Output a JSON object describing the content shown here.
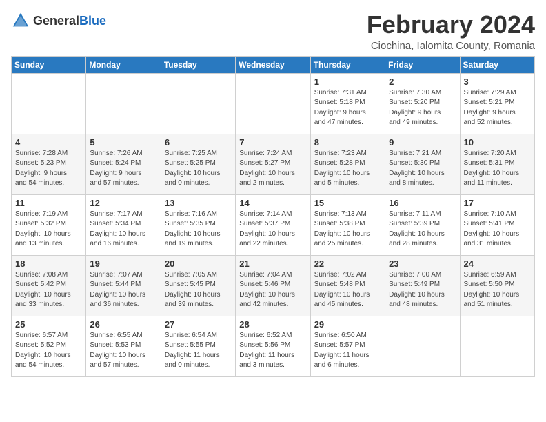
{
  "header": {
    "logo_general": "General",
    "logo_blue": "Blue",
    "title": "February 2024",
    "subtitle": "Ciochina, Ialomita County, Romania"
  },
  "weekdays": [
    "Sunday",
    "Monday",
    "Tuesday",
    "Wednesday",
    "Thursday",
    "Friday",
    "Saturday"
  ],
  "weeks": [
    [
      {
        "day": "",
        "details": ""
      },
      {
        "day": "",
        "details": ""
      },
      {
        "day": "",
        "details": ""
      },
      {
        "day": "",
        "details": ""
      },
      {
        "day": "1",
        "details": "Sunrise: 7:31 AM\nSunset: 5:18 PM\nDaylight: 9 hours\nand 47 minutes."
      },
      {
        "day": "2",
        "details": "Sunrise: 7:30 AM\nSunset: 5:20 PM\nDaylight: 9 hours\nand 49 minutes."
      },
      {
        "day": "3",
        "details": "Sunrise: 7:29 AM\nSunset: 5:21 PM\nDaylight: 9 hours\nand 52 minutes."
      }
    ],
    [
      {
        "day": "4",
        "details": "Sunrise: 7:28 AM\nSunset: 5:23 PM\nDaylight: 9 hours\nand 54 minutes."
      },
      {
        "day": "5",
        "details": "Sunrise: 7:26 AM\nSunset: 5:24 PM\nDaylight: 9 hours\nand 57 minutes."
      },
      {
        "day": "6",
        "details": "Sunrise: 7:25 AM\nSunset: 5:25 PM\nDaylight: 10 hours\nand 0 minutes."
      },
      {
        "day": "7",
        "details": "Sunrise: 7:24 AM\nSunset: 5:27 PM\nDaylight: 10 hours\nand 2 minutes."
      },
      {
        "day": "8",
        "details": "Sunrise: 7:23 AM\nSunset: 5:28 PM\nDaylight: 10 hours\nand 5 minutes."
      },
      {
        "day": "9",
        "details": "Sunrise: 7:21 AM\nSunset: 5:30 PM\nDaylight: 10 hours\nand 8 minutes."
      },
      {
        "day": "10",
        "details": "Sunrise: 7:20 AM\nSunset: 5:31 PM\nDaylight: 10 hours\nand 11 minutes."
      }
    ],
    [
      {
        "day": "11",
        "details": "Sunrise: 7:19 AM\nSunset: 5:32 PM\nDaylight: 10 hours\nand 13 minutes."
      },
      {
        "day": "12",
        "details": "Sunrise: 7:17 AM\nSunset: 5:34 PM\nDaylight: 10 hours\nand 16 minutes."
      },
      {
        "day": "13",
        "details": "Sunrise: 7:16 AM\nSunset: 5:35 PM\nDaylight: 10 hours\nand 19 minutes."
      },
      {
        "day": "14",
        "details": "Sunrise: 7:14 AM\nSunset: 5:37 PM\nDaylight: 10 hours\nand 22 minutes."
      },
      {
        "day": "15",
        "details": "Sunrise: 7:13 AM\nSunset: 5:38 PM\nDaylight: 10 hours\nand 25 minutes."
      },
      {
        "day": "16",
        "details": "Sunrise: 7:11 AM\nSunset: 5:39 PM\nDaylight: 10 hours\nand 28 minutes."
      },
      {
        "day": "17",
        "details": "Sunrise: 7:10 AM\nSunset: 5:41 PM\nDaylight: 10 hours\nand 31 minutes."
      }
    ],
    [
      {
        "day": "18",
        "details": "Sunrise: 7:08 AM\nSunset: 5:42 PM\nDaylight: 10 hours\nand 33 minutes."
      },
      {
        "day": "19",
        "details": "Sunrise: 7:07 AM\nSunset: 5:44 PM\nDaylight: 10 hours\nand 36 minutes."
      },
      {
        "day": "20",
        "details": "Sunrise: 7:05 AM\nSunset: 5:45 PM\nDaylight: 10 hours\nand 39 minutes."
      },
      {
        "day": "21",
        "details": "Sunrise: 7:04 AM\nSunset: 5:46 PM\nDaylight: 10 hours\nand 42 minutes."
      },
      {
        "day": "22",
        "details": "Sunrise: 7:02 AM\nSunset: 5:48 PM\nDaylight: 10 hours\nand 45 minutes."
      },
      {
        "day": "23",
        "details": "Sunrise: 7:00 AM\nSunset: 5:49 PM\nDaylight: 10 hours\nand 48 minutes."
      },
      {
        "day": "24",
        "details": "Sunrise: 6:59 AM\nSunset: 5:50 PM\nDaylight: 10 hours\nand 51 minutes."
      }
    ],
    [
      {
        "day": "25",
        "details": "Sunrise: 6:57 AM\nSunset: 5:52 PM\nDaylight: 10 hours\nand 54 minutes."
      },
      {
        "day": "26",
        "details": "Sunrise: 6:55 AM\nSunset: 5:53 PM\nDaylight: 10 hours\nand 57 minutes."
      },
      {
        "day": "27",
        "details": "Sunrise: 6:54 AM\nSunset: 5:55 PM\nDaylight: 11 hours\nand 0 minutes."
      },
      {
        "day": "28",
        "details": "Sunrise: 6:52 AM\nSunset: 5:56 PM\nDaylight: 11 hours\nand 3 minutes."
      },
      {
        "day": "29",
        "details": "Sunrise: 6:50 AM\nSunset: 5:57 PM\nDaylight: 11 hours\nand 6 minutes."
      },
      {
        "day": "",
        "details": ""
      },
      {
        "day": "",
        "details": ""
      }
    ]
  ]
}
